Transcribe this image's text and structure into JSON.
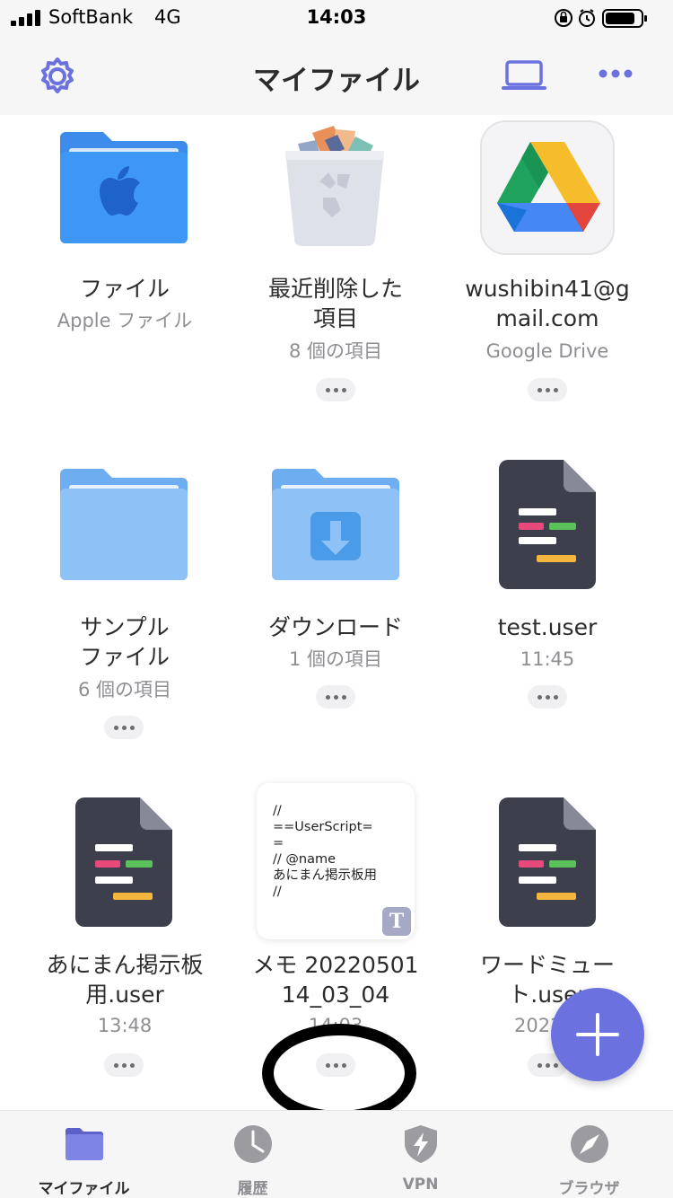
{
  "status": {
    "carrier": "SoftBank",
    "network": "4G",
    "time": "14:03"
  },
  "header": {
    "title": "マイファイル"
  },
  "items": [
    {
      "name": "ファイル",
      "name2": "",
      "sub": "Apple ファイル",
      "icon": "apple-folder-icon"
    },
    {
      "name": "最近削除した",
      "name2": "項目",
      "sub": "8 個の項目",
      "icon": "trash-icon"
    },
    {
      "name": "wushibin41@g",
      "name2": "mail.com",
      "sub": "Google Drive",
      "icon": "google-drive-icon"
    },
    {
      "name": "サンプル",
      "name2": "ファイル",
      "sub": "6 個の項目",
      "icon": "folder-icon"
    },
    {
      "name": "ダウンロード",
      "name2": "",
      "sub": "1 個の項目",
      "icon": "download-folder-icon"
    },
    {
      "name": "test.user",
      "name2": "",
      "sub": "11:45",
      "icon": "script-file-icon"
    },
    {
      "name": "あにまん掲示板",
      "name2": "用.user",
      "sub": "13:48",
      "icon": "script-file-icon"
    },
    {
      "name": "メモ 20220501",
      "name2": "14_03_04",
      "sub": "14:03",
      "icon": "text-memo-icon"
    },
    {
      "name": "ワードミュー",
      "name2": "ト.user",
      "sub": "2022/0",
      "icon": "script-file-icon"
    }
  ],
  "memo_preview": "//\n==UserScript=\n=\n// @name\nあにまん掲示板用\n//",
  "memo_badge": "T",
  "tabs": [
    {
      "label": "マイファイル",
      "icon": "folder-icon"
    },
    {
      "label": "履歴",
      "icon": "clock-icon"
    },
    {
      "label": "VPN",
      "icon": "shield-bolt-icon"
    },
    {
      "label": "ブラウザ",
      "icon": "compass-icon"
    }
  ],
  "colors": {
    "accent": "#6b72e0",
    "folder_blue": "#3b8cf0",
    "folder_light": "#8ec0f6",
    "script_bg": "#3d3f4d"
  }
}
